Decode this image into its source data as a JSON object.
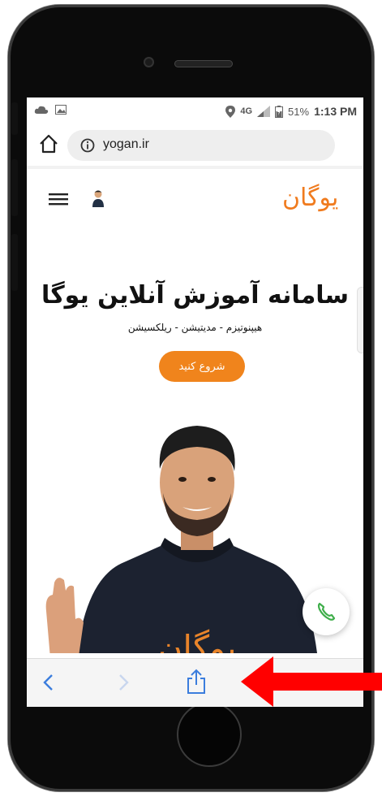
{
  "status_bar": {
    "network": "4G",
    "battery": "51%",
    "time": "1:13 PM"
  },
  "browser": {
    "url": "yogan.ir"
  },
  "site": {
    "logo_text": "یوگان",
    "hero_title": "سامانه آموزش آنلاین یوگا",
    "hero_subtitle": "هیپنوتیزم - مدیتیشن - ریلکسیشن",
    "cta_label": "شروع کنید",
    "shirt_text": "یوگان"
  },
  "colors": {
    "accent": "#f0841c",
    "browser_blue": "#3b7ddd",
    "arrow_red": "#ff0000",
    "call_green": "#3fae4a"
  },
  "icons": {
    "home": "home-icon",
    "info": "info-icon",
    "menu": "menu-icon",
    "back": "chevron-left-icon",
    "forward": "chevron-right-icon",
    "share": "share-icon",
    "call": "phone-icon"
  }
}
